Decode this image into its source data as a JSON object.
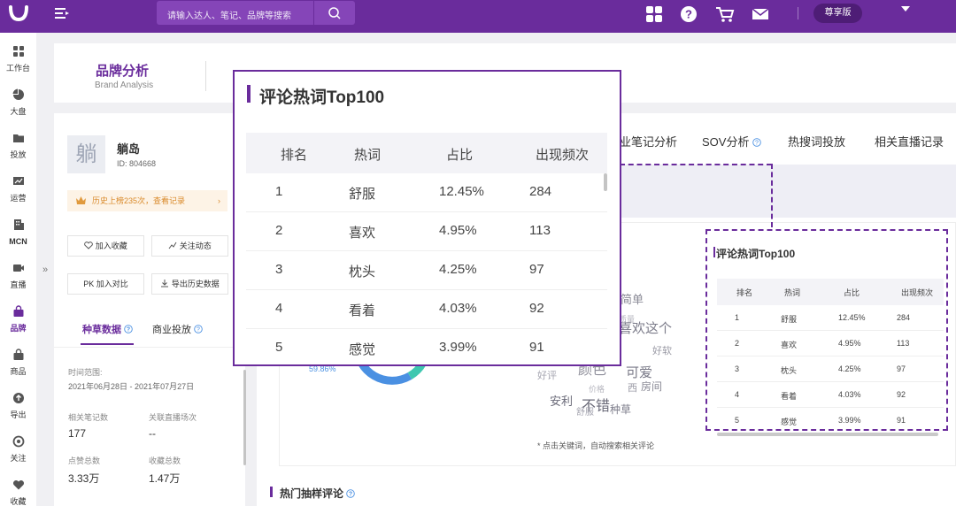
{
  "topbar": {
    "search_placeholder": "请输入达人、笔记、品牌等搜索",
    "vip_label": "尊享版",
    "icons": [
      "logo-icon",
      "menu-toggle-icon",
      "search-icon",
      "grid-icon",
      "help-icon",
      "cart-icon",
      "mail-icon",
      "dropdown-caret-icon"
    ]
  },
  "sidebar": {
    "items": [
      {
        "label": "工作台",
        "icon": "dashboard-icon"
      },
      {
        "label": "大盘",
        "icon": "pie-chart-icon"
      },
      {
        "label": "投放",
        "icon": "folder-icon"
      },
      {
        "label": "运营",
        "icon": "chart-icon"
      },
      {
        "label": "MCN",
        "icon": "building-icon"
      },
      {
        "label": "直播",
        "icon": "video-icon"
      },
      {
        "label": "品牌",
        "icon": "bag-icon",
        "active": true
      },
      {
        "label": "商品",
        "icon": "box-icon"
      },
      {
        "label": "导出",
        "icon": "export-icon"
      },
      {
        "label": "关注",
        "icon": "eye-icon"
      },
      {
        "label": "收藏",
        "icon": "heart-icon"
      }
    ],
    "collapse_glyph": "»"
  },
  "page_header": {
    "title": "品牌分析",
    "subtitle": "Brand Analysis"
  },
  "profile": {
    "avatar_char": "躺",
    "name": "躺岛",
    "id": "ID: 804668",
    "history": "历史上榜235次，查看记录",
    "history_arrow": "›",
    "buttons": {
      "add_favorite": "加入收藏",
      "follow": "关注动态",
      "compare": "PK 加入对比",
      "export": "导出历史数据"
    },
    "tabs": {
      "seeding": "种草数据",
      "commercial": "商业投放"
    },
    "time_label": "时间范围:",
    "time_range": "2021年06月28日 - 2021年07月27日",
    "stats": [
      {
        "label": "相关笔记数",
        "value": "177"
      },
      {
        "label": "关联直播场次",
        "value": "--"
      },
      {
        "label": "点赞总数",
        "value": "3.33万"
      },
      {
        "label": "收藏总数",
        "value": "1.47万"
      }
    ]
  },
  "main": {
    "tabs": [
      "业笔记分析",
      "SOV分析",
      "热搜词投放",
      "相关直播记录"
    ],
    "donut_label": "59.86%",
    "hint": "* 点击关键词，自动搜索相关评论",
    "section_title": "热门抽样评论",
    "cloud_words": [
      "简单",
      "喜欢这个",
      "好软",
      "安利",
      "颜色",
      "可爱",
      "房间",
      "不错",
      "种草",
      "舒服",
      "好评",
      "价格",
      "质量",
      "西"
    ]
  },
  "table": {
    "title": "评论热词Top100",
    "headers": [
      "排名",
      "热词",
      "占比",
      "出现频次"
    ],
    "rows": [
      [
        "1",
        "舒服",
        "12.45%",
        "284"
      ],
      [
        "2",
        "喜欢",
        "4.95%",
        "113"
      ],
      [
        "3",
        "枕头",
        "4.25%",
        "97"
      ],
      [
        "4",
        "看着",
        "4.03%",
        "92"
      ],
      [
        "5",
        "感觉",
        "3.99%",
        "91"
      ]
    ]
  },
  "colors": {
    "brand_purple": "#6a2c9c",
    "accent_blue": "#4a90e2",
    "donut_teal": "#3ec7b0"
  }
}
